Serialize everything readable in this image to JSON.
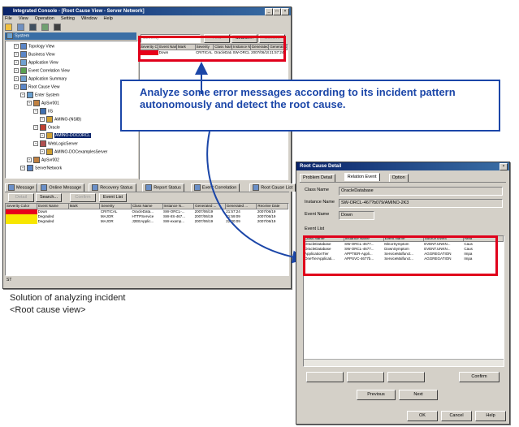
{
  "main_window": {
    "title": "Integrated Console - [Root Cause View - Server Network]",
    "menu": [
      "File",
      "View",
      "Operation",
      "Setting",
      "Window",
      "Help"
    ],
    "toolbar_icons": [
      "open-icon",
      "print-icon",
      "home-icon",
      "tree-icon",
      "help-icon"
    ],
    "tree_header": "System",
    "tree": [
      {
        "label": "Topology View",
        "indent": 1,
        "icon": "network-icon"
      },
      {
        "label": "Business View",
        "indent": 1,
        "icon": "business-icon"
      },
      {
        "label": "Application View",
        "indent": 1,
        "icon": "application-icon"
      },
      {
        "label": "Event Correlation View",
        "indent": 1,
        "icon": "event-icon"
      },
      {
        "label": "Application Summary",
        "indent": 1,
        "icon": "summary-icon"
      },
      {
        "label": "Root Cause View",
        "indent": 1,
        "icon": "rootcause-icon"
      },
      {
        "label": "Enter System",
        "indent": 2,
        "icon": "system-icon"
      },
      {
        "label": "ApSvr001",
        "indent": 3,
        "icon": "server-icon"
      },
      {
        "label": "IIS",
        "indent": 4,
        "icon": "iis-icon"
      },
      {
        "label": "AMINO-(NSIB)",
        "indent": 5,
        "icon": "db-icon"
      },
      {
        "label": "Oracle",
        "indent": 4,
        "icon": "oracle-icon"
      },
      {
        "label": "AMINO-DOCORCL",
        "indent": 5,
        "icon": "db-icon",
        "selected": true
      },
      {
        "label": "WebLogicServer",
        "indent": 4,
        "icon": "weblogic-icon"
      },
      {
        "label": "AMINO-DOCexamplesServer",
        "indent": 5,
        "icon": "db-icon"
      },
      {
        "label": "ApSvr002",
        "indent": 3,
        "icon": "server-icon"
      },
      {
        "label": "ServerNetwork",
        "indent": 2,
        "icon": "network-icon"
      }
    ],
    "top_toolbar": {
      "combo": "Severity",
      "filter_button": "Find",
      "search_button": "Search...",
      "confirm_button": "Confirm"
    },
    "top_table": {
      "columns": [
        "Severity Color",
        "Event Name",
        "Mark",
        "Severity",
        "Class Name",
        "Instance N...",
        "Generated ...",
        "Generated ..."
      ],
      "rows": [
        [
          "",
          "Down",
          "",
          "CRITICAL",
          "OracleData...",
          "SW-ORCL-...",
          "2007/06/19",
          "21:57:24"
        ]
      ]
    },
    "bottom_tabs": [
      "Message",
      "Online Message",
      "Recovery Status",
      "Report Status",
      "Event Correlation",
      "Root Cause List"
    ],
    "bottom_toolbar": {
      "b1": "Detail",
      "b2": "Search...",
      "b3": "Confirm",
      "b4": "Event List"
    },
    "bottom_table": {
      "columns": [
        "Severity Color",
        "Event Name",
        "Mark",
        "Severity",
        "Class Name",
        "Instance N...",
        "Generated ...",
        "Generated ...",
        "Receive Date"
      ],
      "rows": [
        [
          "",
          "Down",
          "",
          "CRITICAL",
          "OracleData...",
          "SW-ORCL-...",
          "2007/06/19",
          "21:57:24",
          "2007/06/19"
        ],
        [
          "",
          "Degraded",
          "",
          "MAJOR",
          "HTTPService",
          "SW-IIS-467...",
          "2007/06/19",
          "21:59:09",
          "2007/06/19"
        ],
        [
          "",
          "Degraded",
          "",
          "MAJOR",
          "J2EEApplic...",
          "SW-examp...",
          "2007/06/19",
          "22:00:09",
          "2007/06/19"
        ]
      ],
      "row_colors": [
        "#e8001a",
        "#f7e600",
        "#f7e600"
      ]
    },
    "status": "ST"
  },
  "callout": {
    "text": "Analyze some error messages according to its incident pattern autonomously and detect the root cause."
  },
  "caption": {
    "line1": "Solution of analyzing incident",
    "line2": "<Root cause view>"
  },
  "dialog": {
    "title": "Root Cause Detail",
    "tabs": [
      "Problem Detail",
      "Relation Event",
      "Option"
    ],
    "class_name_label": "Class Name",
    "class_name_value": "OracleDatabase",
    "instance_label": "Instance Name",
    "instance_value": "SW-ORCL-467?b079/AMINO-2K3",
    "event_label": "Event Name",
    "event_value": "Down",
    "event_list_label": "Event List",
    "table": {
      "columns": [
        "Class Name",
        "Instance Name",
        "Event Name",
        "Source Event",
        "Rela"
      ],
      "rows": [
        [
          "OracleDatabase",
          "SW-ORCL-4677...",
          "MinorSymptom",
          "EVENT.UNKN...",
          "Caus"
        ],
        [
          "OracleDatabase",
          "SW-ORCL-4677...",
          "DownSymptom",
          "EVENT.UNKN...",
          "Caus"
        ],
        [
          "ApplicationTier",
          "APPTIER-Appli...",
          "ServiceMalfunct...",
          "AGGREGATION",
          "Impa"
        ],
        [
          "OneTierApplicati...",
          "APPSVC-4677b...",
          "ServiceMalfunct...",
          "AGGREGATION",
          "Impa"
        ]
      ]
    },
    "buttons": {
      "b1": "",
      "b2": "",
      "b3": "",
      "confirm": "Confirm",
      "previous": "Previous",
      "next": "Next",
      "ok": "OK",
      "cancel": "Cancel",
      "help": "Help"
    }
  },
  "colors": {
    "accent": "#1b46a8",
    "highlight": "#e0001b",
    "critical": "#e8001a",
    "major": "#f7e600",
    "titlebar": "#0a246a"
  }
}
